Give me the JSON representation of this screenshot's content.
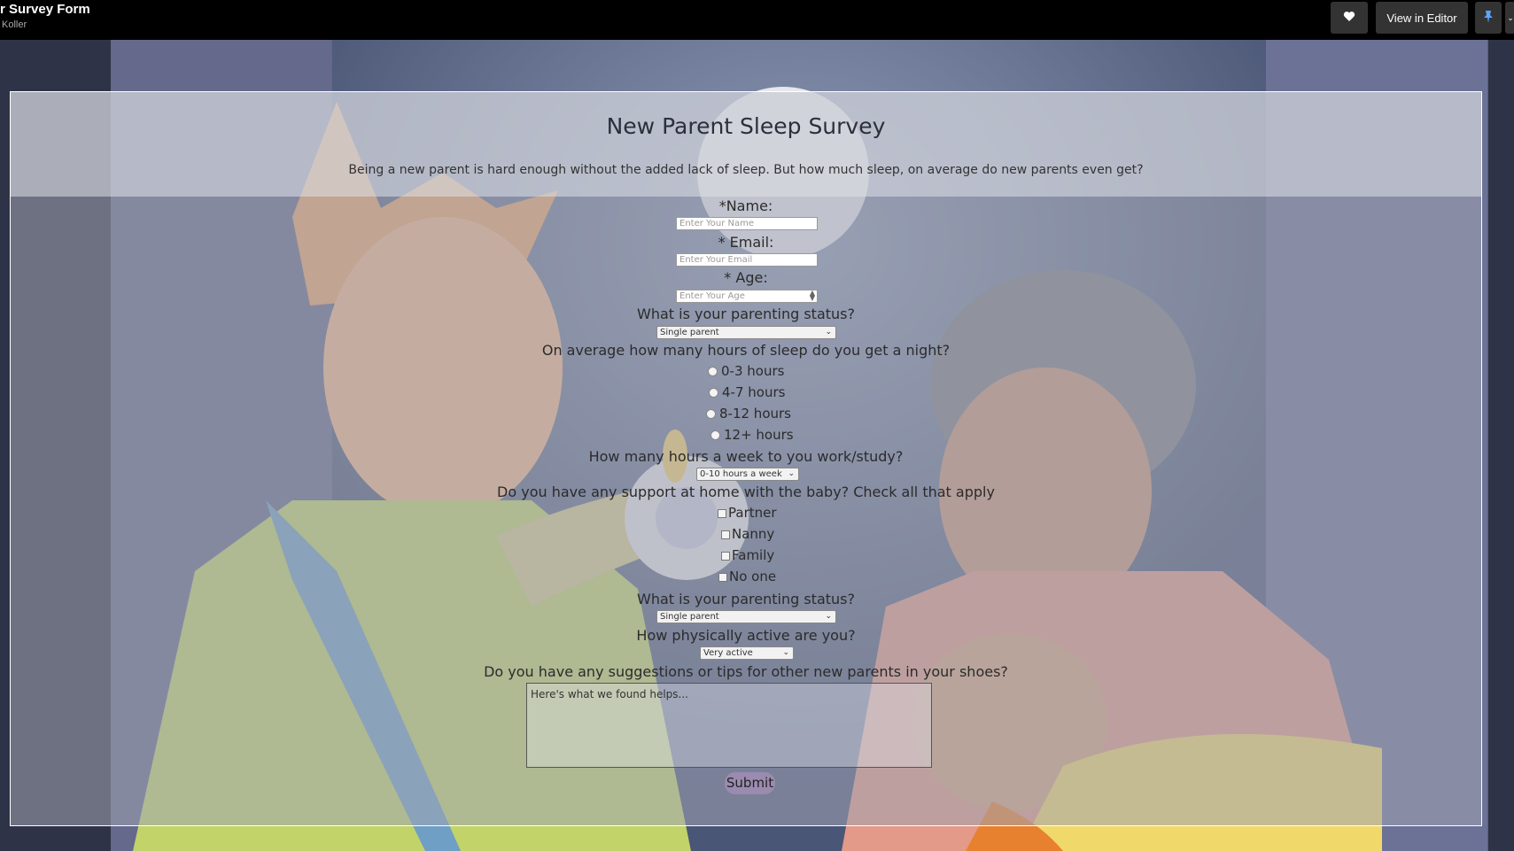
{
  "window": {
    "title": "r Survey Form",
    "author": "Koller",
    "view_in_editor_label": "View in Editor"
  },
  "icons": [
    "heart-icon",
    "pin-icon",
    "chevron-down-icon"
  ],
  "survey": {
    "title": "New Parent Sleep Survey",
    "description": "Being a new parent is hard enough without the added lack of sleep. But how much sleep, on average do new parents even get?",
    "name_label": "*Name:",
    "name_placeholder": "Enter Your Name",
    "email_label": "* Email:",
    "email_placeholder": "Enter Your Email",
    "age_label": "* Age:",
    "age_placeholder": "Enter Your Age",
    "status_question": "What is your parenting status?",
    "status_selected": "Single parent",
    "sleep_question": "On average how many hours of sleep do you get a night?",
    "sleep_options": [
      "0-3 hours",
      "4-7 hours",
      "8-12 hours",
      "12+ hours"
    ],
    "work_question": "How many hours a week to you work/study?",
    "work_selected": "0-10 hours a week",
    "support_question": "Do you have any support at home with the baby? Check all that apply",
    "support_options": [
      "Partner",
      "Nanny",
      "Family",
      "No one"
    ],
    "status_question_2": "What is your parenting status?",
    "status_selected_2": "Single parent",
    "activity_question": "How physically active are you?",
    "activity_selected": "Very active",
    "suggestions_question": "Do you have any suggestions or tips for other new parents in your shoes?",
    "suggestions_placeholder": "Here's what we found helps...",
    "submit_label": "Submit"
  },
  "colors": {
    "topbar": "#000000",
    "panel_border": "#ffffff",
    "submit": "#9b8bb0",
    "curtain": "#3b4760",
    "dad_hair": "#e8a468",
    "dad_robe": "#c2d36a",
    "mom_hair": "#7c7f84",
    "mom_robe": "#e39a88",
    "baby_blanket": "#f0d86a"
  }
}
